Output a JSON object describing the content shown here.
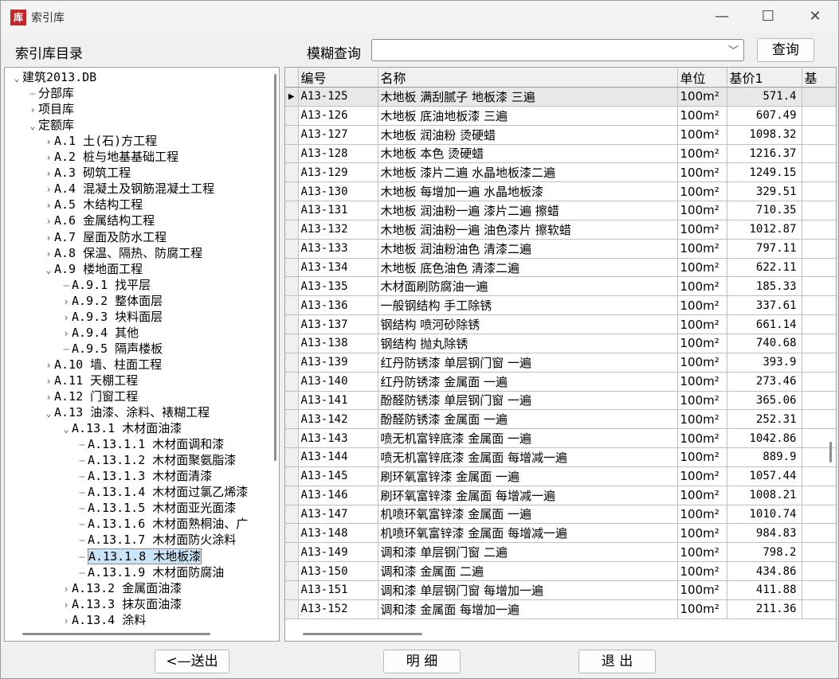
{
  "window": {
    "title": "索引库",
    "app_icon_glyph": "库",
    "min_glyph": "—",
    "max_glyph": "☐",
    "close_glyph": "✕"
  },
  "toolbar": {
    "catalog_label": "索引库目录",
    "fuzzy_label": "模糊查询",
    "search_value": "",
    "query_button": "查询"
  },
  "tree": [
    {
      "depth": 0,
      "toggle": "v",
      "label": "建筑2013.DB"
    },
    {
      "depth": 1,
      "toggle": "-",
      "label": "分部库"
    },
    {
      "depth": 1,
      "toggle": ">",
      "label": "项目库"
    },
    {
      "depth": 1,
      "toggle": "v",
      "label": "定额库"
    },
    {
      "depth": 2,
      "toggle": ">",
      "label": "A.1 土(石)方工程"
    },
    {
      "depth": 2,
      "toggle": ">",
      "label": "A.2 桩与地基基础工程"
    },
    {
      "depth": 2,
      "toggle": ">",
      "label": "A.3 砌筑工程"
    },
    {
      "depth": 2,
      "toggle": ">",
      "label": "A.4 混凝土及钢筋混凝土工程"
    },
    {
      "depth": 2,
      "toggle": ">",
      "label": "A.5 木结构工程"
    },
    {
      "depth": 2,
      "toggle": ">",
      "label": "A.6 金属结构工程"
    },
    {
      "depth": 2,
      "toggle": ">",
      "label": "A.7 屋面及防水工程"
    },
    {
      "depth": 2,
      "toggle": ">",
      "label": "A.8 保温、隔热、防腐工程"
    },
    {
      "depth": 2,
      "toggle": "v",
      "label": "A.9 楼地面工程"
    },
    {
      "depth": 3,
      "toggle": "-",
      "label": "A.9.1 找平层"
    },
    {
      "depth": 3,
      "toggle": ">",
      "label": "A.9.2 整体面层"
    },
    {
      "depth": 3,
      "toggle": ">",
      "label": "A.9.3 块料面层"
    },
    {
      "depth": 3,
      "toggle": ">",
      "label": "A.9.4 其他"
    },
    {
      "depth": 3,
      "toggle": "-",
      "label": "A.9.5 隔声楼板"
    },
    {
      "depth": 2,
      "toggle": ">",
      "label": "A.10 墙、柱面工程"
    },
    {
      "depth": 2,
      "toggle": ">",
      "label": "A.11 天棚工程"
    },
    {
      "depth": 2,
      "toggle": ">",
      "label": "A.12 门窗工程"
    },
    {
      "depth": 2,
      "toggle": "v",
      "label": "A.13 油漆、涂料、裱糊工程"
    },
    {
      "depth": 3,
      "toggle": "v",
      "label": "A.13.1 木材面油漆"
    },
    {
      "depth": 4,
      "toggle": "-",
      "label": "A.13.1.1 木材面调和漆"
    },
    {
      "depth": 4,
      "toggle": "-",
      "label": "A.13.1.2 木材面聚氨脂漆"
    },
    {
      "depth": 4,
      "toggle": "-",
      "label": "A.13.1.3 木材面清漆"
    },
    {
      "depth": 4,
      "toggle": "-",
      "label": "A.13.1.4 木材面过氯乙烯漆"
    },
    {
      "depth": 4,
      "toggle": "-",
      "label": "A.13.1.5 木材面亚光面漆"
    },
    {
      "depth": 4,
      "toggle": "-",
      "label": "A.13.1.6 木材面熟桐油、广"
    },
    {
      "depth": 4,
      "toggle": "-",
      "label": "A.13.1.7 木材面防火涂料"
    },
    {
      "depth": 4,
      "toggle": "-",
      "label": "A.13.1.8 木地板漆",
      "selected": true
    },
    {
      "depth": 4,
      "toggle": "-",
      "label": "A.13.1.9 木材面防腐油"
    },
    {
      "depth": 3,
      "toggle": ">",
      "label": "A.13.2 金属面油漆"
    },
    {
      "depth": 3,
      "toggle": ">",
      "label": "A.13.3 抹灰面油漆"
    },
    {
      "depth": 3,
      "toggle": ">",
      "label": "A.13.4 涂料"
    }
  ],
  "table": {
    "columns": [
      "编号",
      "名称",
      "单位",
      "基价1",
      "基"
    ],
    "rows": [
      [
        "A13-125",
        "木地板 满刮腻子 地板漆 三遍",
        "100m²",
        "571.4"
      ],
      [
        "A13-126",
        "木地板 底油地板漆 三遍",
        "100m²",
        "607.49"
      ],
      [
        "A13-127",
        "木地板 润油粉 烫硬蜡",
        "100m²",
        "1098.32"
      ],
      [
        "A13-128",
        "木地板 本色 烫硬蜡",
        "100m²",
        "1216.37"
      ],
      [
        "A13-129",
        "木地板 漆片二遍 水晶地板漆二遍",
        "100m²",
        "1249.15"
      ],
      [
        "A13-130",
        "木地板 每增加一遍 水晶地板漆",
        "100m²",
        "329.51"
      ],
      [
        "A13-131",
        "木地板 润油粉一遍 漆片二遍 擦蜡",
        "100m²",
        "710.35"
      ],
      [
        "A13-132",
        "木地板 润油粉一遍 油色漆片 擦软蜡",
        "100m²",
        "1012.87"
      ],
      [
        "A13-133",
        "木地板 润油粉油色 清漆二遍",
        "100m²",
        "797.11"
      ],
      [
        "A13-134",
        "木地板 底色油色 清漆二遍",
        "100m²",
        "622.11"
      ],
      [
        "A13-135",
        "木材面刷防腐油一遍",
        "100m²",
        "185.33"
      ],
      [
        "A13-136",
        "一般钢结构 手工除锈",
        "100m²",
        "337.61"
      ],
      [
        "A13-137",
        "钢结构 喷河砂除锈",
        "100m²",
        "661.14"
      ],
      [
        "A13-138",
        "钢结构 抛丸除锈",
        "100m²",
        "740.68"
      ],
      [
        "A13-139",
        "红丹防锈漆 单层钢门窗 一遍",
        "100m²",
        "393.9"
      ],
      [
        "A13-140",
        "红丹防锈漆 金属面 一遍",
        "100m²",
        "273.46"
      ],
      [
        "A13-141",
        "酚醛防锈漆 单层钢门窗 一遍",
        "100m²",
        "365.06"
      ],
      [
        "A13-142",
        "酚醛防锈漆 金属面 一遍",
        "100m²",
        "252.31"
      ],
      [
        "A13-143",
        "喷无机富锌底漆 金属面 一遍",
        "100m²",
        "1042.86"
      ],
      [
        "A13-144",
        "喷无机富锌底漆 金属面 每增减一遍",
        "100m²",
        "889.9"
      ],
      [
        "A13-145",
        "刷环氧富锌漆 金属面 一遍",
        "100m²",
        "1057.44"
      ],
      [
        "A13-146",
        "刷环氧富锌漆 金属面 每增减一遍",
        "100m²",
        "1008.21"
      ],
      [
        "A13-147",
        "机喷环氧富锌漆 金属面 一遍",
        "100m²",
        "1010.74"
      ],
      [
        "A13-148",
        "机喷环氧富锌漆 金属面 每增减一遍",
        "100m²",
        "984.83"
      ],
      [
        "A13-149",
        "调和漆 单层钢门窗 二遍",
        "100m²",
        "798.2"
      ],
      [
        "A13-150",
        "调和漆 金属面 二遍",
        "100m²",
        "434.86"
      ],
      [
        "A13-151",
        "调和漆 单层钢门窗 每增加一遍",
        "100m²",
        "411.88"
      ],
      [
        "A13-152",
        "调和漆 金属面 每增加一遍",
        "100m²",
        "211.36"
      ]
    ],
    "selected_row_index": 0,
    "row_indicator_glyph": "▶"
  },
  "footer": {
    "send_button": "<—送出",
    "detail_button": "明 细",
    "exit_button": "退 出"
  }
}
